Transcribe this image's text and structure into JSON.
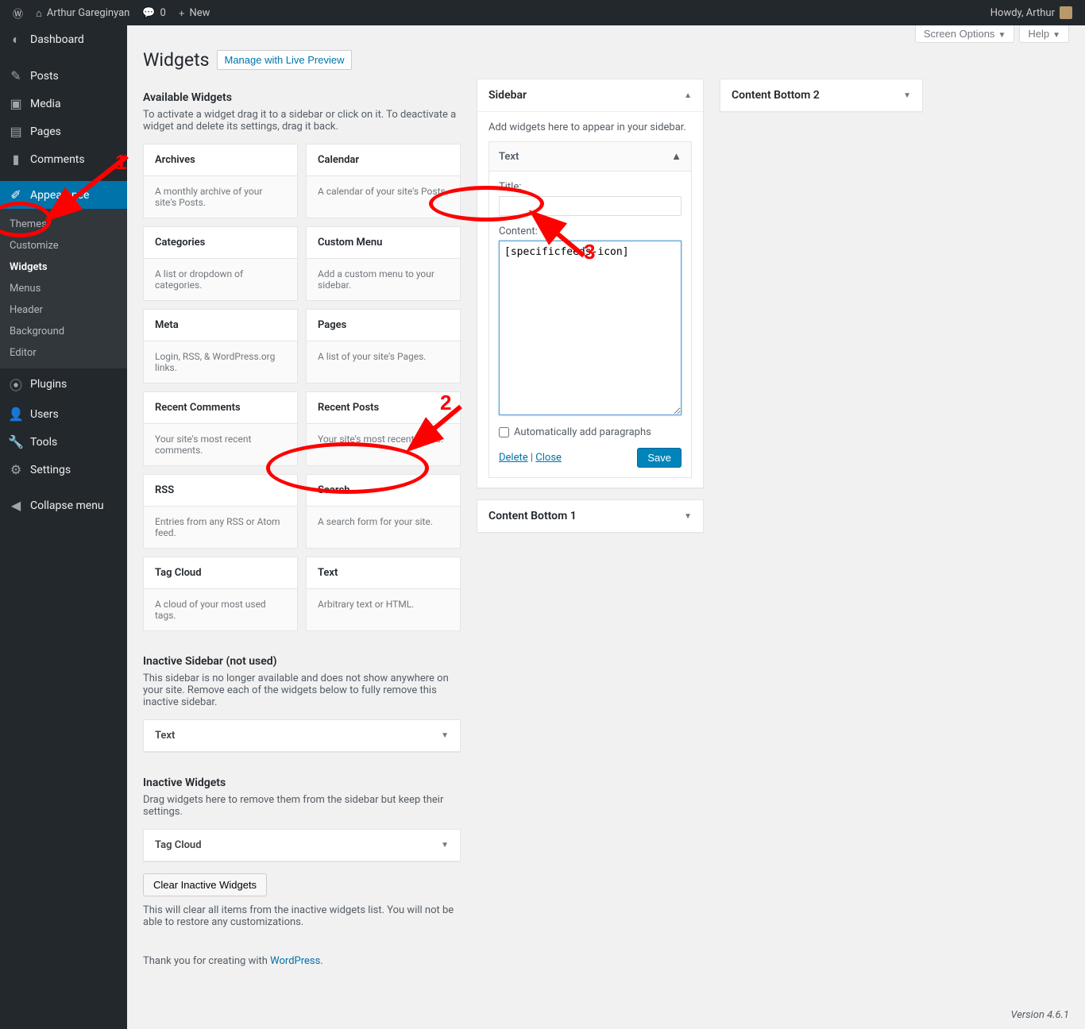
{
  "toolbar": {
    "site_name": "Arthur Gareginyan",
    "comments_count": "0",
    "new_label": "New",
    "howdy": "Howdy, Arthur"
  },
  "sidebar": {
    "items": [
      {
        "icon": "◷",
        "label": "Dashboard"
      },
      {
        "icon": "📌",
        "label": "Posts"
      },
      {
        "icon": "🖼",
        "label": "Media"
      },
      {
        "icon": "▤",
        "label": "Pages"
      },
      {
        "icon": "💬",
        "label": "Comments"
      },
      {
        "icon": "🖌",
        "label": "Appearance",
        "active": true
      },
      {
        "icon": "🔌",
        "label": "Plugins"
      },
      {
        "icon": "👤",
        "label": "Users"
      },
      {
        "icon": "🔧",
        "label": "Tools"
      },
      {
        "icon": "⚙",
        "label": "Settings"
      },
      {
        "icon": "◀",
        "label": "Collapse menu"
      }
    ],
    "submenu": [
      {
        "label": "Themes"
      },
      {
        "label": "Customize"
      },
      {
        "label": "Widgets",
        "current": true
      },
      {
        "label": "Menus"
      },
      {
        "label": "Header"
      },
      {
        "label": "Background"
      },
      {
        "label": "Editor"
      }
    ]
  },
  "screen_meta": {
    "screen_options": "Screen Options",
    "help": "Help"
  },
  "page": {
    "title": "Widgets",
    "live_preview": "Manage with Live Preview"
  },
  "available": {
    "heading": "Available Widgets",
    "desc": "To activate a widget drag it to a sidebar or click on it. To deactivate a widget and delete its settings, drag it back.",
    "widgets": [
      {
        "name": "Archives",
        "desc": "A monthly archive of your site's Posts."
      },
      {
        "name": "Calendar",
        "desc": "A calendar of your site's Posts."
      },
      {
        "name": "Categories",
        "desc": "A list or dropdown of categories."
      },
      {
        "name": "Custom Menu",
        "desc": "Add a custom menu to your sidebar."
      },
      {
        "name": "Meta",
        "desc": "Login, RSS, & WordPress.org links."
      },
      {
        "name": "Pages",
        "desc": "A list of your site's Pages."
      },
      {
        "name": "Recent Comments",
        "desc": "Your site's most recent comments."
      },
      {
        "name": "Recent Posts",
        "desc": "Your site's most recent Posts."
      },
      {
        "name": "RSS",
        "desc": "Entries from any RSS or Atom feed."
      },
      {
        "name": "Search",
        "desc": "A search form for your site."
      },
      {
        "name": "Tag Cloud",
        "desc": "A cloud of your most used tags."
      },
      {
        "name": "Text",
        "desc": "Arbitrary text or HTML."
      }
    ]
  },
  "inactive_sidebar": {
    "heading": "Inactive Sidebar (not used)",
    "desc": "This sidebar is no longer available and does not show anywhere on your site. Remove each of the widgets below to fully remove this inactive sidebar.",
    "widget": "Text"
  },
  "inactive_widgets": {
    "heading": "Inactive Widgets",
    "desc": "Drag widgets here to remove them from the sidebar but keep their settings.",
    "widget": "Tag Cloud",
    "clear_btn": "Clear Inactive Widgets",
    "clear_desc": "This will clear all items from the inactive widgets list. You will not be able to restore any customizations."
  },
  "sidebar_panel": {
    "title": "Sidebar",
    "desc": "Add widgets here to appear in your sidebar.",
    "text_widget": {
      "head": "Text",
      "title_label": "Title:",
      "title_value": "",
      "content_label": "Content:",
      "content_value": "[specificfeeds-icon]",
      "auto_para": "Automatically add paragraphs",
      "delete": "Delete",
      "close": "Close",
      "save": "Save"
    }
  },
  "content_bottom_1": "Content Bottom 1",
  "content_bottom_2": "Content Bottom 2",
  "footer": {
    "thanks_prefix": "Thank you for creating with ",
    "wp": "WordPress",
    "dot": ".",
    "version": "Version 4.6.1"
  },
  "annotations": {
    "n1": "1",
    "n2": "2",
    "n3": "3"
  }
}
